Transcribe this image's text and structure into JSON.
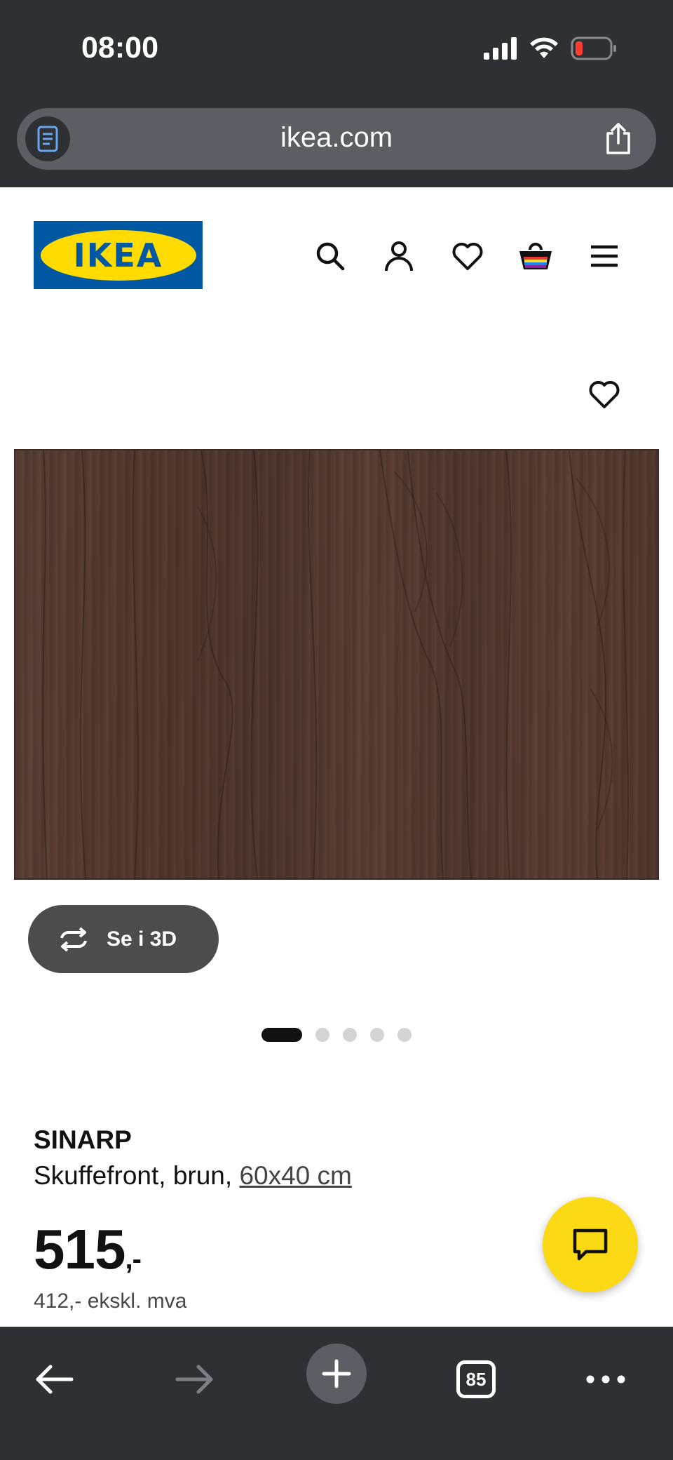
{
  "status_bar": {
    "time": "08:00"
  },
  "browser": {
    "url": "ikea.com",
    "tab_count": "85"
  },
  "header": {
    "logo_text": "IKEA",
    "logo_colors": {
      "blue": "#0058a3",
      "yellow": "#ffdb00"
    },
    "icons": [
      "search-icon",
      "account-icon",
      "wishlist-icon",
      "cart-icon",
      "menu-icon"
    ]
  },
  "gallery": {
    "view_3d_label": "Se i 3D",
    "slide_count": 5,
    "active_slide": 1
  },
  "product": {
    "name": "SINARP",
    "description": "Skuffefront, brun, ",
    "size": "60x40 cm",
    "price_main": "515",
    "price_suffix": ",-",
    "price_ex_vat": "412,- ekskl. mva"
  },
  "colors": {
    "chrome": "#2e3034",
    "chat_button": "#fbd914",
    "wood": "#54392f"
  }
}
